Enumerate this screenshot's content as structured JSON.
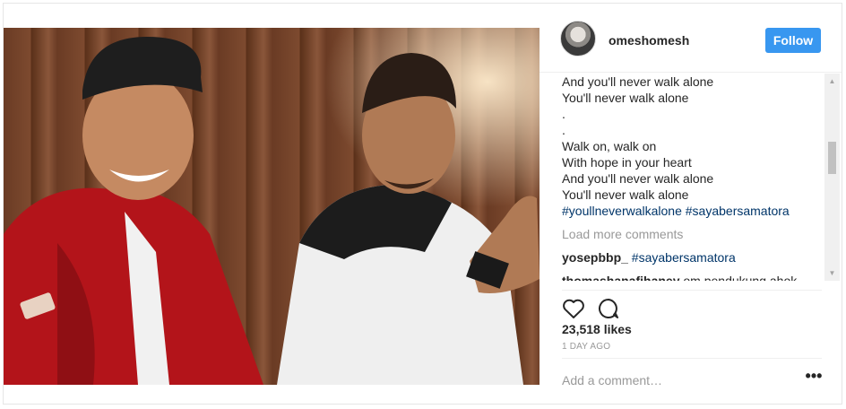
{
  "header": {
    "username": "omeshomesh",
    "follow_label": "Follow"
  },
  "caption_lines": [
    "And you'll never walk alone",
    "You'll never walk alone",
    ".",
    ".",
    "Walk on, walk on",
    "With hope in your heart",
    "And you'll never walk alone",
    "You'll never walk alone"
  ],
  "hashtags": [
    "#youllneverwalkalone",
    "#sayabersamatora"
  ],
  "load_more": "Load more comments",
  "comments": [
    {
      "user": "yosepbbp_",
      "tag": "#sayabersamatora",
      "text": ""
    },
    {
      "user": "thomashanafihaney",
      "tag": "",
      "text": "om pendukung ahok"
    }
  ],
  "likes": "23,518 likes",
  "time_ago": "1 DAY AGO",
  "comment_placeholder": "Add a comment…",
  "more_glyph": "•••",
  "icons": {
    "like": "heart-icon",
    "comment": "speech-bubble-icon",
    "more": "ellipsis-icon"
  },
  "colors": {
    "accent": "#3897f0",
    "hashtag": "#003569",
    "muted": "#999999"
  }
}
